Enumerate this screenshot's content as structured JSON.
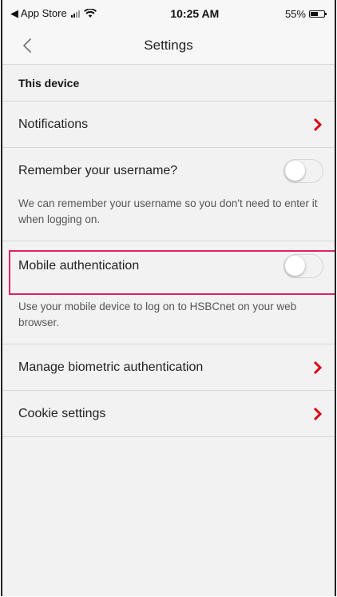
{
  "status_bar": {
    "back_app": "◀ App Store",
    "time": "10:25 AM",
    "battery_text": "55%",
    "battery_level": 0.55
  },
  "nav": {
    "title": "Settings"
  },
  "section": {
    "title": "This device"
  },
  "items": {
    "notifications": {
      "label": "Notifications"
    },
    "remember_username": {
      "label": "Remember your username?",
      "enabled": false,
      "description": "We can remember your username so you don't need to enter it when logging on."
    },
    "mobile_auth": {
      "label": "Mobile authentication",
      "enabled": false,
      "description": "Use your mobile device to log on to HSBCnet on your web browser."
    },
    "biometric": {
      "label": "Manage biometric authentication"
    },
    "cookies": {
      "label": "Cookie settings"
    }
  },
  "colors": {
    "accent": "#db0011",
    "highlight": "#e0245e",
    "nav_chevron": "#777777"
  }
}
